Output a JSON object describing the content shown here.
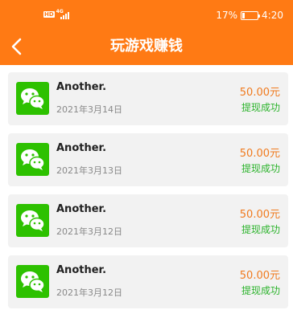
{
  "statusbar": {
    "hd": "HD",
    "net": "4G",
    "battery": "17%",
    "time": "4:20"
  },
  "header": {
    "title": "玩游戏赚钱"
  },
  "colors": {
    "header": "#ff7a14",
    "amount": "#f07a1e",
    "status": "#2bb32b",
    "icon": "#2dc100"
  },
  "records": [
    {
      "name": "Another.",
      "date": "2021年3月14日",
      "amount": "50.00元",
      "status": "提现成功",
      "icon": "wechat-icon"
    },
    {
      "name": "Another.",
      "date": "2021年3月13日",
      "amount": "50.00元",
      "status": "提现成功",
      "icon": "wechat-icon"
    },
    {
      "name": "Another.",
      "date": "2021年3月12日",
      "amount": "50.00元",
      "status": "提现成功",
      "icon": "wechat-icon"
    },
    {
      "name": "Another.",
      "date": "2021年3月12日",
      "amount": "50.00元",
      "status": "提现成功",
      "icon": "wechat-icon"
    }
  ]
}
